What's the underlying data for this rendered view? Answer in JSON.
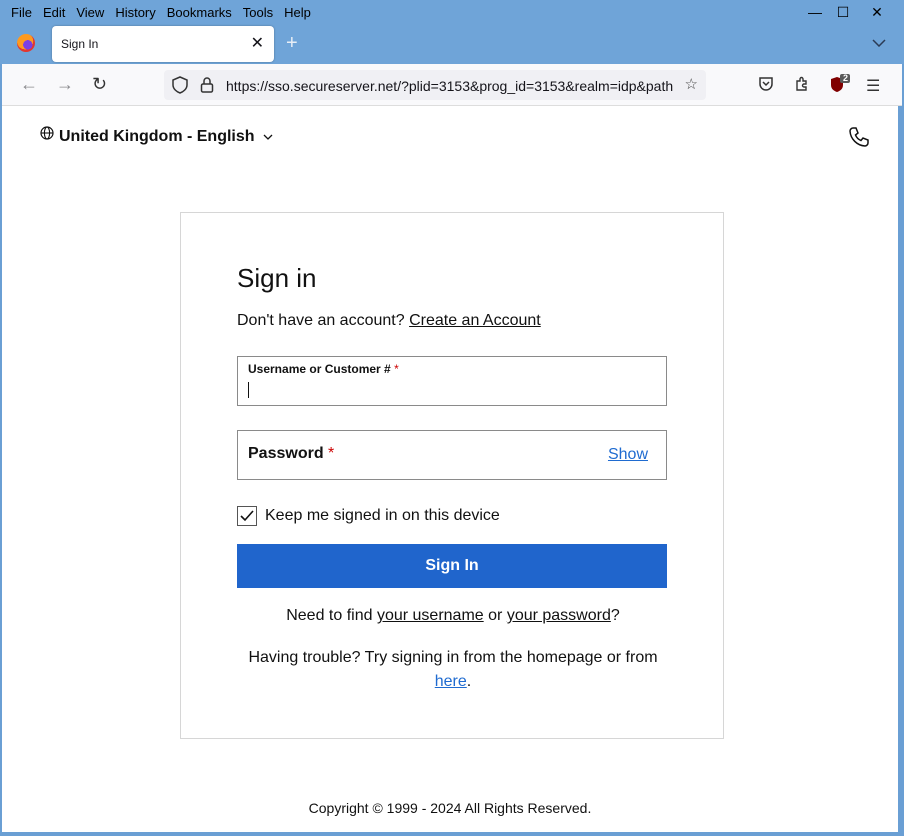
{
  "browser": {
    "menu": [
      "File",
      "Edit",
      "View",
      "History",
      "Bookmarks",
      "Tools",
      "Help"
    ],
    "window_controls": {
      "minimize": "—",
      "maximize": "☐",
      "close": "✕"
    },
    "tab": {
      "title": "Sign In",
      "close": "✕"
    },
    "newtab": "+",
    "tablist": "⌄",
    "url": "https://sso.secureserver.net/?plid=3153&prog_id=3153&realm=idp&path",
    "ublock_badge": "2"
  },
  "header": {
    "locale": "United Kingdom - English"
  },
  "signin": {
    "title": "Sign in",
    "no_account": "Don't have an account?",
    "create_account": "Create an Account",
    "username_label": "Username or Customer #",
    "required_mark": "*",
    "password_label": "Password",
    "show": "Show",
    "keep_signed_in": "Keep me signed in on this device",
    "keep_checked": true,
    "button": "Sign In",
    "forgot_prefix": "Need to find",
    "forgot_username": "your username",
    "forgot_or": "or",
    "forgot_password": "your password",
    "forgot_suffix": "?",
    "trouble_text": "Having trouble? Try signing in from the homepage or from",
    "trouble_link": "here",
    "trouble_end": "."
  },
  "footer": {
    "copyright": "Copyright © 1999 - 2024 All Rights Reserved."
  },
  "colors": {
    "primary_button": "#2065cc",
    "link_blue": "#1f6bd0",
    "required": "#cc0000"
  }
}
